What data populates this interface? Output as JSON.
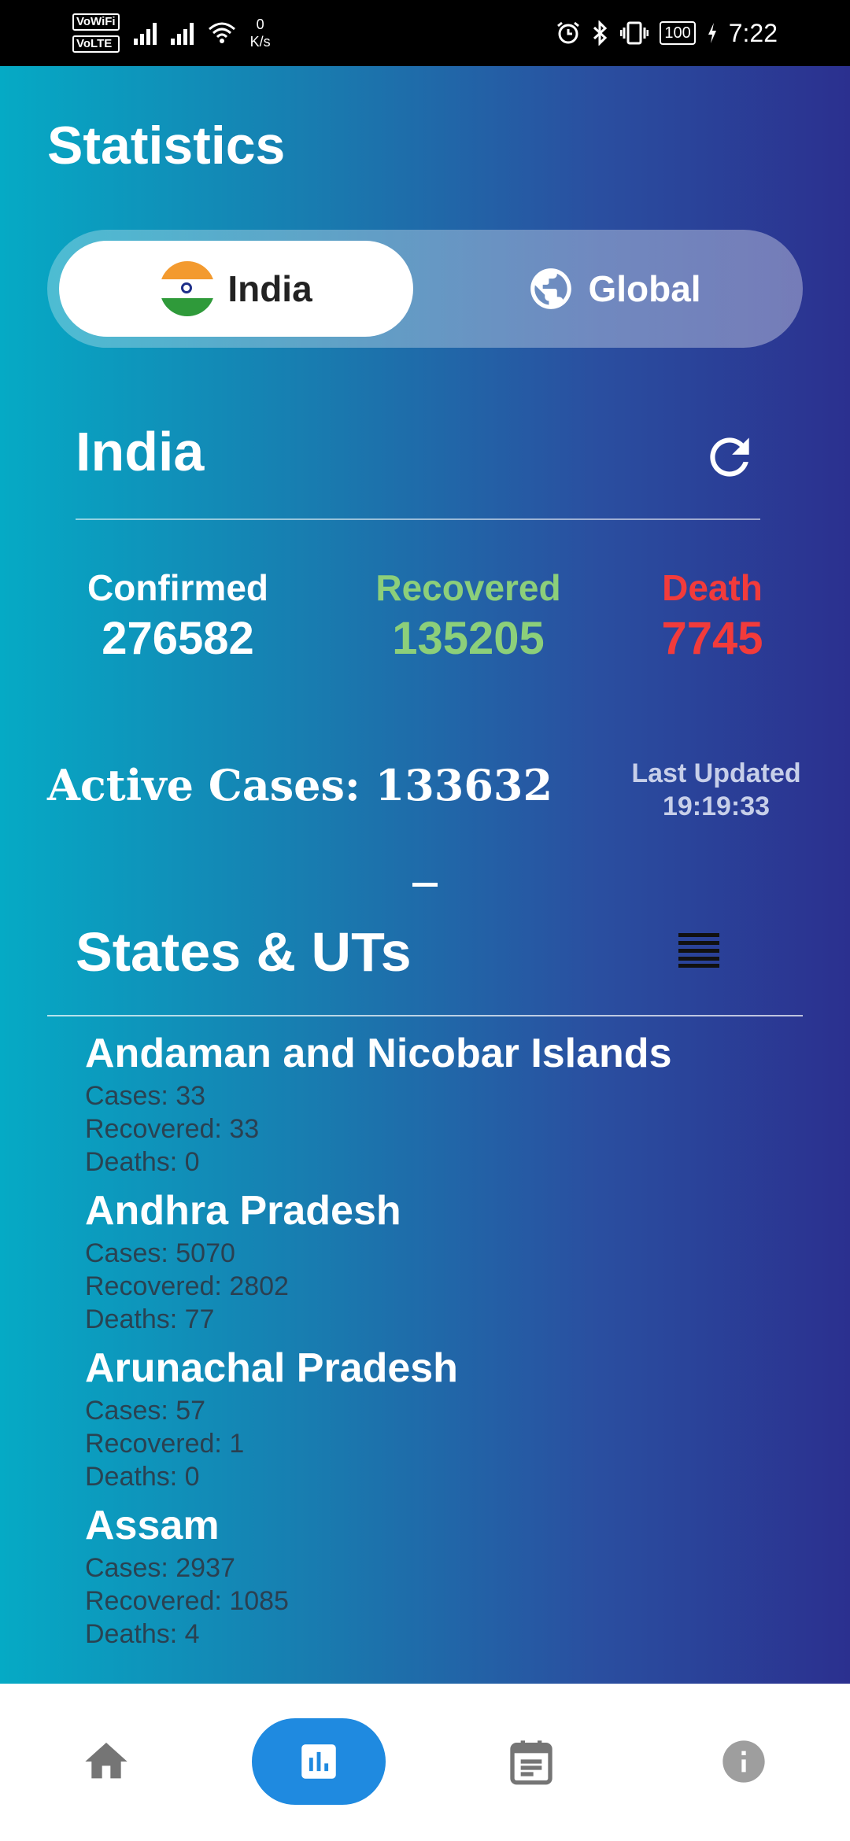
{
  "status_bar": {
    "sim1_tags": [
      "VoWiFi",
      "VoLTE"
    ],
    "net_speed_value": "0",
    "net_speed_unit": "K/s",
    "battery": "100",
    "time": "7:22"
  },
  "page": {
    "title": "Statistics"
  },
  "region_toggle": {
    "options": [
      {
        "label": "India",
        "icon": "india-flag-icon",
        "selected": true
      },
      {
        "label": "Global",
        "icon": "globe-icon",
        "selected": false
      }
    ]
  },
  "summary": {
    "country": "India",
    "confirmed_label": "Confirmed",
    "confirmed_value": "276582",
    "recovered_label": "Recovered",
    "recovered_value": "135205",
    "death_label": "Death",
    "death_value": "7745",
    "active_cases_text": "Active Cases: 133632",
    "last_updated_label": "Last Updated",
    "last_updated_time": "19:19:33"
  },
  "states": {
    "title": "States & UTs",
    "items": [
      {
        "name": "Andaman and Nicobar Islands",
        "cases": "Cases: 33",
        "recovered": "Recovered: 33",
        "deaths": "Deaths: 0"
      },
      {
        "name": "Andhra Pradesh",
        "cases": "Cases: 5070",
        "recovered": "Recovered: 2802",
        "deaths": "Deaths: 77"
      },
      {
        "name": "Arunachal Pradesh",
        "cases": "Cases: 57",
        "recovered": "Recovered: 1",
        "deaths": "Deaths: 0"
      },
      {
        "name": "Assam",
        "cases": "Cases: 2937",
        "recovered": "Recovered: 1085",
        "deaths": "Deaths: 4"
      }
    ]
  },
  "bottom_nav": {
    "items": [
      {
        "icon": "home-icon",
        "active": false
      },
      {
        "icon": "bar-chart-icon",
        "active": true
      },
      {
        "icon": "calendar-news-icon",
        "active": false
      },
      {
        "icon": "info-icon",
        "active": false
      }
    ]
  },
  "colors": {
    "recovered": "#8ccf7a",
    "death": "#f23b3b",
    "nav_active": "#1f8ae0"
  }
}
